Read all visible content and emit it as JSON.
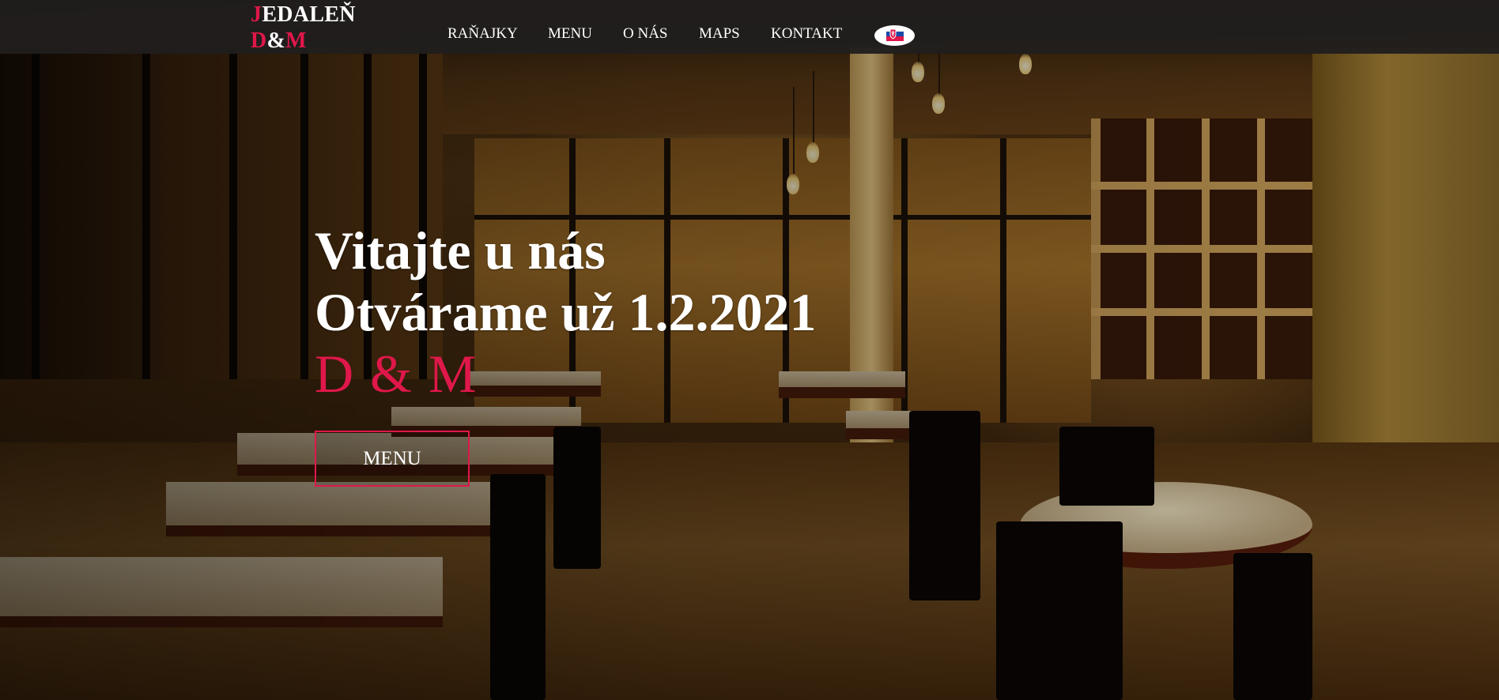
{
  "logo": {
    "line1_initial": "J",
    "line1_rest": "EDALEŇ",
    "line2_d": "D",
    "line2_amp": "&",
    "line2_m": "M"
  },
  "nav": {
    "items": [
      {
        "label": "RAŇAJKY"
      },
      {
        "label": "MENU"
      },
      {
        "label": "O NÁS"
      },
      {
        "label": "MAPS"
      },
      {
        "label": "KONTAKT"
      }
    ],
    "flag_icon": "country-flag-icon"
  },
  "hero": {
    "line1": "Vitajte u nás",
    "line2": "Otvárame už 1.2.2021",
    "brand": "D & M",
    "button_label": "MENU",
    "background": "restaurant-interior-photo"
  },
  "colors": {
    "accent": "#e0174a",
    "navbar": "#201e1d",
    "text": "#ffffff"
  }
}
